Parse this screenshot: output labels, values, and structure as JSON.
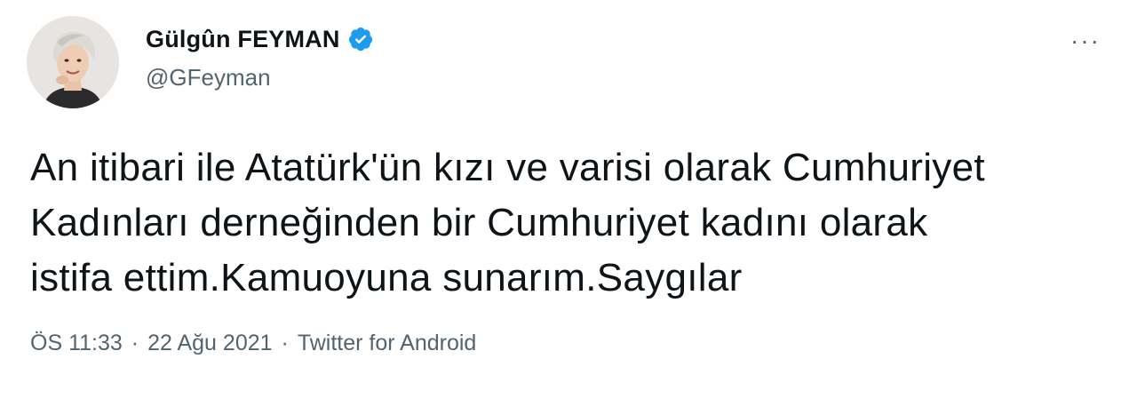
{
  "author": {
    "name": "Gülgûn FEYMAN",
    "handle": "@GFeyman",
    "verified_icon": "verified-badge-icon",
    "avatar_icon": "profile-avatar"
  },
  "more_label": "···",
  "tweet": {
    "text": "An itibari ile Atatürk'ün kızı ve varisi olarak Cumhuriyet\nKadınları derneğinden bir Cumhuriyet kadını olarak\nistifa ettim.Kamuoyuna sunarım.Saygılar"
  },
  "meta": {
    "time": "ÖS 11:33",
    "separator": "·",
    "date": "22 Ağu 2021",
    "source": "Twitter for Android"
  },
  "colors": {
    "verified": "#1d9bf0",
    "text": "#0f1419",
    "secondary": "#536471"
  }
}
